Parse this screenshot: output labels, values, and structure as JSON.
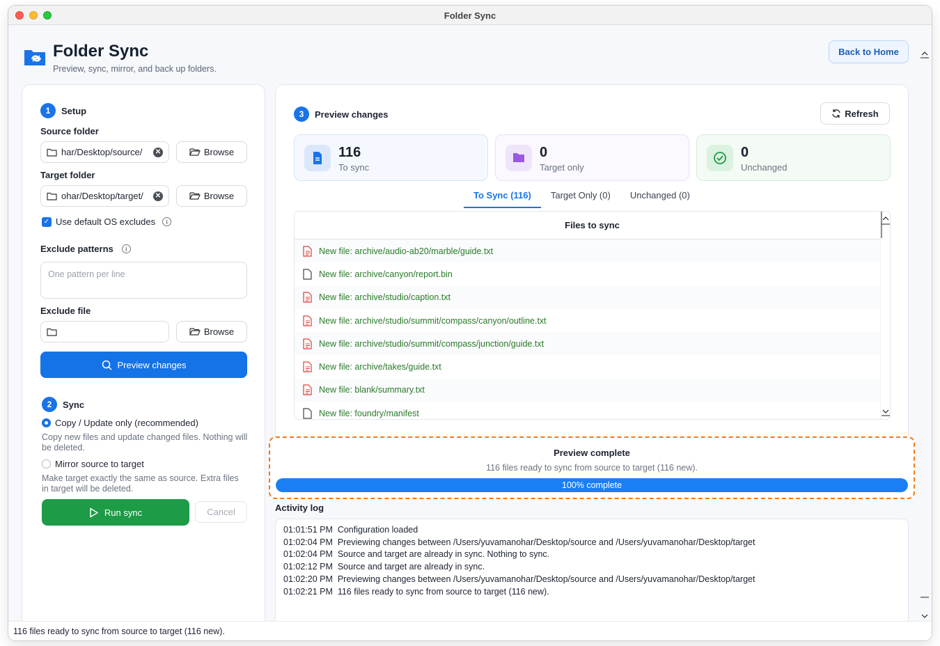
{
  "window": {
    "title": "Folder Sync"
  },
  "header": {
    "title": "Folder Sync",
    "subtitle": "Preview, sync, mirror, and back up folders.",
    "back_label": "Back to Home"
  },
  "setup": {
    "step_num": "1",
    "step_label": "Setup",
    "source_label": "Source folder",
    "source_value": "har/Desktop/source/",
    "target_label": "Target folder",
    "target_value": "ohar/Desktop/target/",
    "browse_label": "Browse",
    "default_excludes_label": "Use default OS excludes",
    "exclude_patterns_label": "Exclude patterns",
    "exclude_patterns_placeholder": "One pattern per line",
    "exclude_file_label": "Exclude file",
    "preview_button": "Preview changes"
  },
  "sync": {
    "step_num": "2",
    "step_label": "Sync",
    "option1_label": "Copy / Update only (recommended)",
    "option1_desc": "Copy new files and update changed files. Nothing will be deleted.",
    "option2_label": "Mirror source to target",
    "option2_desc": "Make target exactly the same as source. Extra files in target will be deleted.",
    "run_label": "Run sync",
    "cancel_label": "Cancel"
  },
  "preview": {
    "step_num": "3",
    "step_label": "Preview changes",
    "refresh_label": "Refresh",
    "cards": [
      {
        "value": "116",
        "label": "To sync",
        "icon": "document-icon"
      },
      {
        "value": "0",
        "label": "Target only",
        "icon": "folder-icon"
      },
      {
        "value": "0",
        "label": "Unchanged",
        "icon": "check-circle-icon"
      }
    ],
    "tabs": [
      "To Sync (116)",
      "Target Only (0)",
      "Unchanged (0)"
    ],
    "list_header": "Files to sync",
    "files": [
      {
        "text": "New file: archive/audio-ab20/marble/guide.txt",
        "icon": "text-file-icon"
      },
      {
        "text": "New file: archive/canyon/report.bin",
        "icon": "file-icon"
      },
      {
        "text": "New file: archive/studio/caption.txt",
        "icon": "text-file-icon"
      },
      {
        "text": "New file: archive/studio/summit/compass/canyon/outline.txt",
        "icon": "text-file-icon"
      },
      {
        "text": "New file: archive/studio/summit/compass/junction/guide.txt",
        "icon": "text-file-icon"
      },
      {
        "text": "New file: archive/takes/guide.txt",
        "icon": "text-file-icon"
      },
      {
        "text": "New file: blank/summary.txt",
        "icon": "text-file-icon"
      },
      {
        "text": "New file: foundry/manifest",
        "icon": "file-icon"
      }
    ]
  },
  "progress": {
    "title": "Preview complete",
    "subtitle": "116 files ready to sync from source to target (116 new).",
    "percent": 100,
    "percent_label": "100% complete"
  },
  "activity": {
    "label": "Activity log",
    "lines": [
      "01:01:51 PM  Configuration loaded",
      "01:02:04 PM  Previewing changes between /Users/yuvamanohar/Desktop/source and /Users/yuvamanohar/Desktop/target",
      "01:02:04 PM  Source and target are already in sync. Nothing to sync.",
      "01:02:12 PM  Source and target are already in sync.",
      "01:02:20 PM  Previewing changes between /Users/yuvamanohar/Desktop/source and /Users/yuvamanohar/Desktop/target",
      "01:02:21 PM  116 files ready to sync from source to target (116 new)."
    ]
  },
  "status_bar": "116 files ready to sync from source to target (116 new).",
  "colors": {
    "accent": "#1a73e8",
    "success": "#1d9b46",
    "highlight": "#f07b1a",
    "file_text": "#2a7a2a"
  }
}
